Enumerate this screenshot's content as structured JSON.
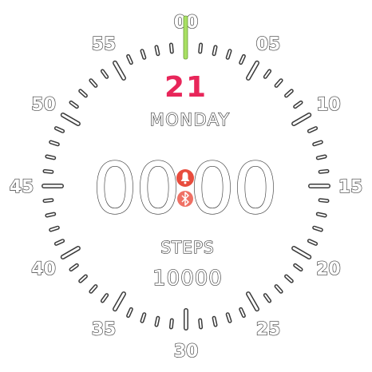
{
  "dial": {
    "numbers": [
      "00",
      "05",
      "10",
      "15",
      "20",
      "25",
      "30",
      "35",
      "40",
      "45",
      "50",
      "55"
    ],
    "second_hand_color": "#a8e063",
    "tick_outline_color": "#3a3a3a"
  },
  "date": {
    "day_number": "21",
    "day_name": "MONDAY",
    "accent_color": "#e8265a"
  },
  "time": {
    "hours": "00",
    "minutes": "00"
  },
  "indicators": {
    "alarm_icon": "bell-icon",
    "bluetooth_icon": "bluetooth-icon",
    "color": "#e84c3d"
  },
  "steps": {
    "label": "STEPS",
    "value": "10000"
  }
}
